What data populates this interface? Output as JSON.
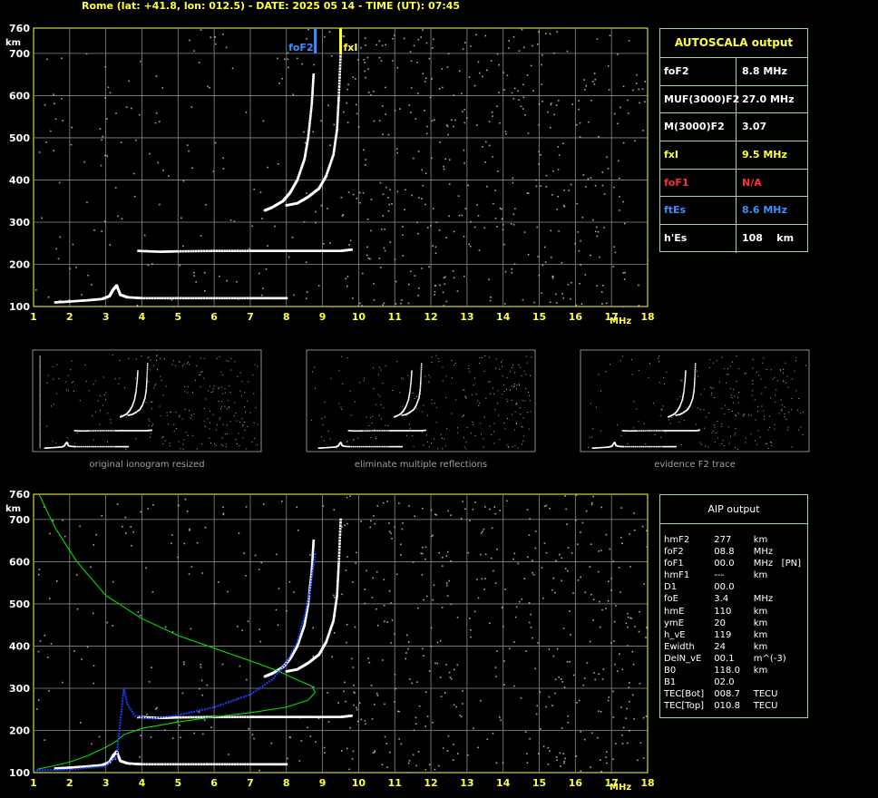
{
  "header": {
    "title": "Rome (lat: +41.8, lon: 012.5) - DATE: 2025 05 14 - TIME (UT): 07:45",
    "color": "#ffff40"
  },
  "chart_data": [
    {
      "type": "scatter",
      "xlabel": "MHz",
      "ylabel": "km",
      "xlim": [
        1,
        18
      ],
      "ylim": [
        100,
        760
      ],
      "xticks": [
        1,
        2,
        3,
        4,
        5,
        6,
        7,
        8,
        9,
        10,
        11,
        12,
        13,
        14,
        15,
        16,
        17,
        18
      ],
      "yticks": [
        100,
        200,
        300,
        400,
        500,
        600,
        700,
        760
      ],
      "grid": true,
      "traces": [
        {
          "name": "E layer trace",
          "color": "#ffffff",
          "x": [
            1.6,
            2.0,
            2.5,
            2.9,
            3.1,
            3.2,
            3.3,
            3.4,
            3.6,
            4.0,
            5.0,
            6.0,
            7.0,
            7.6,
            8.0
          ],
          "y": [
            110,
            112,
            115,
            118,
            125,
            140,
            150,
            128,
            122,
            120,
            120,
            120,
            120,
            120,
            120
          ]
        },
        {
          "name": "Es trace",
          "color": "#ffffff",
          "x": [
            3.9,
            4.5,
            5.0,
            6.0,
            7.0,
            7.5,
            8.0,
            8.5,
            9.0,
            9.5,
            9.8
          ],
          "y": [
            232,
            230,
            231,
            232,
            232,
            232,
            232,
            232,
            232,
            232,
            235
          ]
        },
        {
          "name": "F2 O-trace",
          "color": "#ffffff",
          "x": [
            7.4,
            7.6,
            7.9,
            8.1,
            8.3,
            8.5,
            8.6,
            8.7,
            8.75
          ],
          "y": [
            328,
            335,
            350,
            370,
            400,
            450,
            500,
            580,
            650
          ]
        },
        {
          "name": "F2 X-trace",
          "color": "#ffffff",
          "x": [
            8.0,
            8.3,
            8.6,
            8.9,
            9.1,
            9.3,
            9.4,
            9.45,
            9.5
          ],
          "y": [
            340,
            345,
            360,
            380,
            410,
            460,
            520,
            600,
            700
          ]
        }
      ],
      "markers": [
        {
          "label": "foF2",
          "x": 8.8,
          "color": "#3d8fff"
        },
        {
          "label": "fxI",
          "x": 9.5,
          "color": "#ffff40"
        }
      ]
    },
    {
      "type": "scatter",
      "xlabel": "MHz",
      "ylabel": "km",
      "xlim": [
        1,
        18
      ],
      "ylim": [
        100,
        760
      ],
      "xticks": [
        1,
        2,
        3,
        4,
        5,
        6,
        7,
        8,
        9,
        10,
        11,
        12,
        13,
        14,
        15,
        16,
        17,
        18
      ],
      "yticks": [
        100,
        200,
        300,
        400,
        500,
        600,
        700,
        760
      ],
      "grid": true,
      "traces": [
        {
          "name": "E layer trace",
          "color": "#ffffff",
          "x": [
            1.6,
            2.0,
            2.5,
            2.9,
            3.1,
            3.2,
            3.3,
            3.4,
            3.6,
            4.0,
            5.0,
            6.0,
            7.0,
            7.6,
            8.0
          ],
          "y": [
            110,
            112,
            115,
            118,
            125,
            140,
            150,
            128,
            122,
            120,
            120,
            120,
            120,
            120,
            120
          ]
        },
        {
          "name": "Es trace",
          "color": "#ffffff",
          "x": [
            3.9,
            4.5,
            5.0,
            6.0,
            7.0,
            7.5,
            8.0,
            8.5,
            9.0,
            9.5,
            9.8
          ],
          "y": [
            232,
            230,
            231,
            232,
            232,
            232,
            232,
            232,
            232,
            232,
            235
          ]
        },
        {
          "name": "F2 O-trace",
          "color": "#ffffff",
          "x": [
            7.4,
            7.6,
            7.9,
            8.1,
            8.3,
            8.5,
            8.6,
            8.7,
            8.75
          ],
          "y": [
            328,
            335,
            350,
            370,
            400,
            450,
            500,
            580,
            650
          ]
        },
        {
          "name": "F2 X-trace",
          "color": "#ffffff",
          "x": [
            8.0,
            8.3,
            8.6,
            8.9,
            9.1,
            9.3,
            9.4,
            9.45,
            9.5
          ],
          "y": [
            340,
            345,
            360,
            380,
            410,
            460,
            520,
            600,
            700
          ]
        }
      ],
      "curves": [
        {
          "name": "electron density profile",
          "color": "#00e000",
          "x": [
            1.15,
            1.6,
            2.2,
            3.0,
            4.0,
            5.0,
            6.0,
            7.0,
            7.8,
            8.3,
            8.7,
            8.8,
            8.6,
            8.0,
            7.0,
            6.0,
            5.0,
            4.0,
            3.5,
            3.3,
            3.0,
            2.5,
            2.0,
            1.5,
            1.1
          ],
          "y": [
            760,
            680,
            600,
            520,
            465,
            425,
            395,
            365,
            340,
            320,
            305,
            290,
            272,
            255,
            242,
            232,
            220,
            205,
            190,
            175,
            160,
            140,
            125,
            115,
            108
          ]
        },
        {
          "name": "fitted virtual height trace",
          "color": "#1a3fff",
          "x": [
            1.0,
            2.0,
            3.0,
            3.3,
            3.5,
            3.6,
            3.8,
            4.2,
            5.0,
            6.0,
            7.0,
            7.6,
            8.0,
            8.3,
            8.5,
            8.65,
            8.75,
            8.8
          ],
          "y": [
            105,
            107,
            115,
            140,
            300,
            262,
            235,
            228,
            236,
            255,
            285,
            320,
            360,
            410,
            470,
            530,
            590,
            620
          ]
        }
      ]
    }
  ],
  "thumbnails": [
    {
      "caption": "original ionogram resized"
    },
    {
      "caption": "eliminate multiple reflections"
    },
    {
      "caption": "evidence F2 trace"
    }
  ],
  "autoscala": {
    "title": "AUTOSCALA output",
    "rows": [
      {
        "key": "foF2",
        "value": "8.8 MHz",
        "color": "#ffffff"
      },
      {
        "key": "MUF(3000)F2",
        "value": "27.0 MHz",
        "color": "#ffffff"
      },
      {
        "key": "M(3000)F2",
        "value": "3.07",
        "color": "#ffffff"
      },
      {
        "key": "fxI",
        "value": "9.5 MHz",
        "color": "#ffff40"
      },
      {
        "key": "foF1",
        "value": "N/A",
        "color": "#ff3030"
      },
      {
        "key": "ftEs",
        "value": "8.6 MHz",
        "color": "#3d8fff"
      },
      {
        "key": "h'Es",
        "value": "108    km",
        "color": "#ffffff"
      }
    ]
  },
  "aip": {
    "title": "AIP output",
    "rows": [
      {
        "param": "hmF2",
        "value": "277",
        "unit": "km"
      },
      {
        "param": "foF2",
        "value": "08.8",
        "unit": "MHz"
      },
      {
        "param": "foF1",
        "value": "00.0",
        "unit": "MHz   [PN]"
      },
      {
        "param": "hmF1",
        "value": "---",
        "unit": "km"
      },
      {
        "param": "D1",
        "value": "00.0",
        "unit": ""
      },
      {
        "param": "foE",
        "value": "3.4",
        "unit": "MHz"
      },
      {
        "param": "hmE",
        "value": "110",
        "unit": "km"
      },
      {
        "param": "ymE",
        "value": "20",
        "unit": "km"
      },
      {
        "param": "h_vE",
        "value": "119",
        "unit": "km"
      },
      {
        "param": "Ewidth",
        "value": "24",
        "unit": "km"
      },
      {
        "param": "DelN_vE",
        "value": "00.1",
        "unit": "m^(-3)"
      },
      {
        "param": "B0",
        "value": "118.0",
        "unit": "km"
      },
      {
        "param": "B1",
        "value": "02.0",
        "unit": ""
      },
      {
        "param": "TEC[Bot]",
        "value": "008.7",
        "unit": "TECU"
      },
      {
        "param": "TEC[Top]",
        "value": "010.8",
        "unit": "TECU"
      }
    ]
  }
}
